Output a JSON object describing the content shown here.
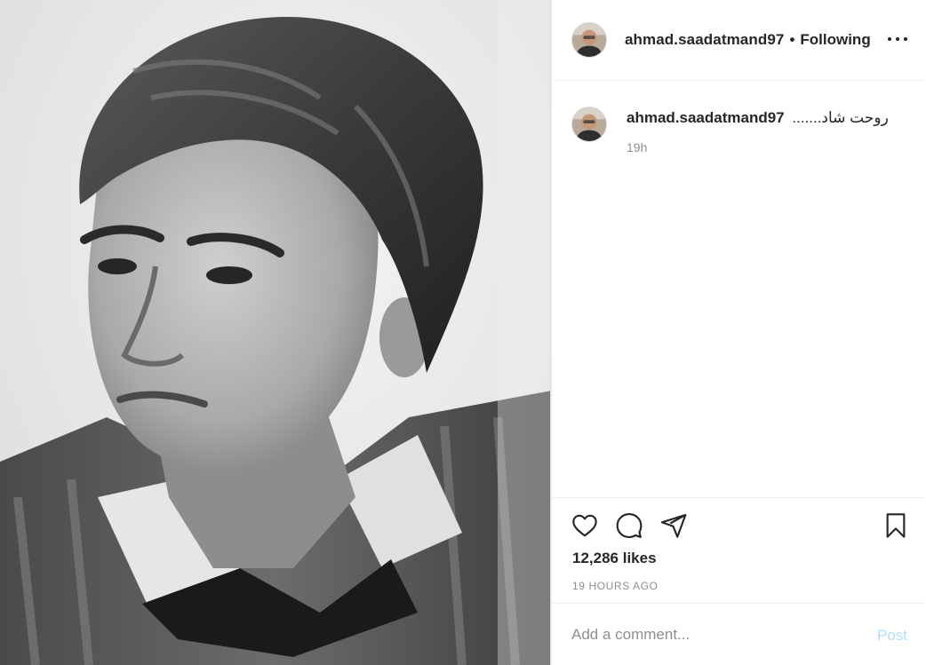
{
  "post": {
    "photo_alt": "Black and white portrait photograph",
    "header": {
      "username": "ahmad.saadatmand97",
      "separator": "•",
      "follow_state": "Following",
      "more_icon": "more-horizontal-icon"
    },
    "caption": {
      "username": "ahmad.saadatmand97",
      "text": "روحت شاد.......",
      "time": "19h"
    },
    "actions": {
      "like_icon": "heart-outline-icon",
      "comment_icon": "comment-bubble-icon",
      "share_icon": "paper-plane-icon",
      "save_icon": "bookmark-outline-icon"
    },
    "likes": "12,286 likes",
    "time_ago": "19 HOURS AGO",
    "comment_box": {
      "placeholder": "Add a comment...",
      "post_label": "Post"
    }
  },
  "colors": {
    "text_primary": "#262626",
    "text_secondary": "#8e8e8e",
    "border": "#efefef",
    "post_button_disabled": "#b2dffc"
  }
}
